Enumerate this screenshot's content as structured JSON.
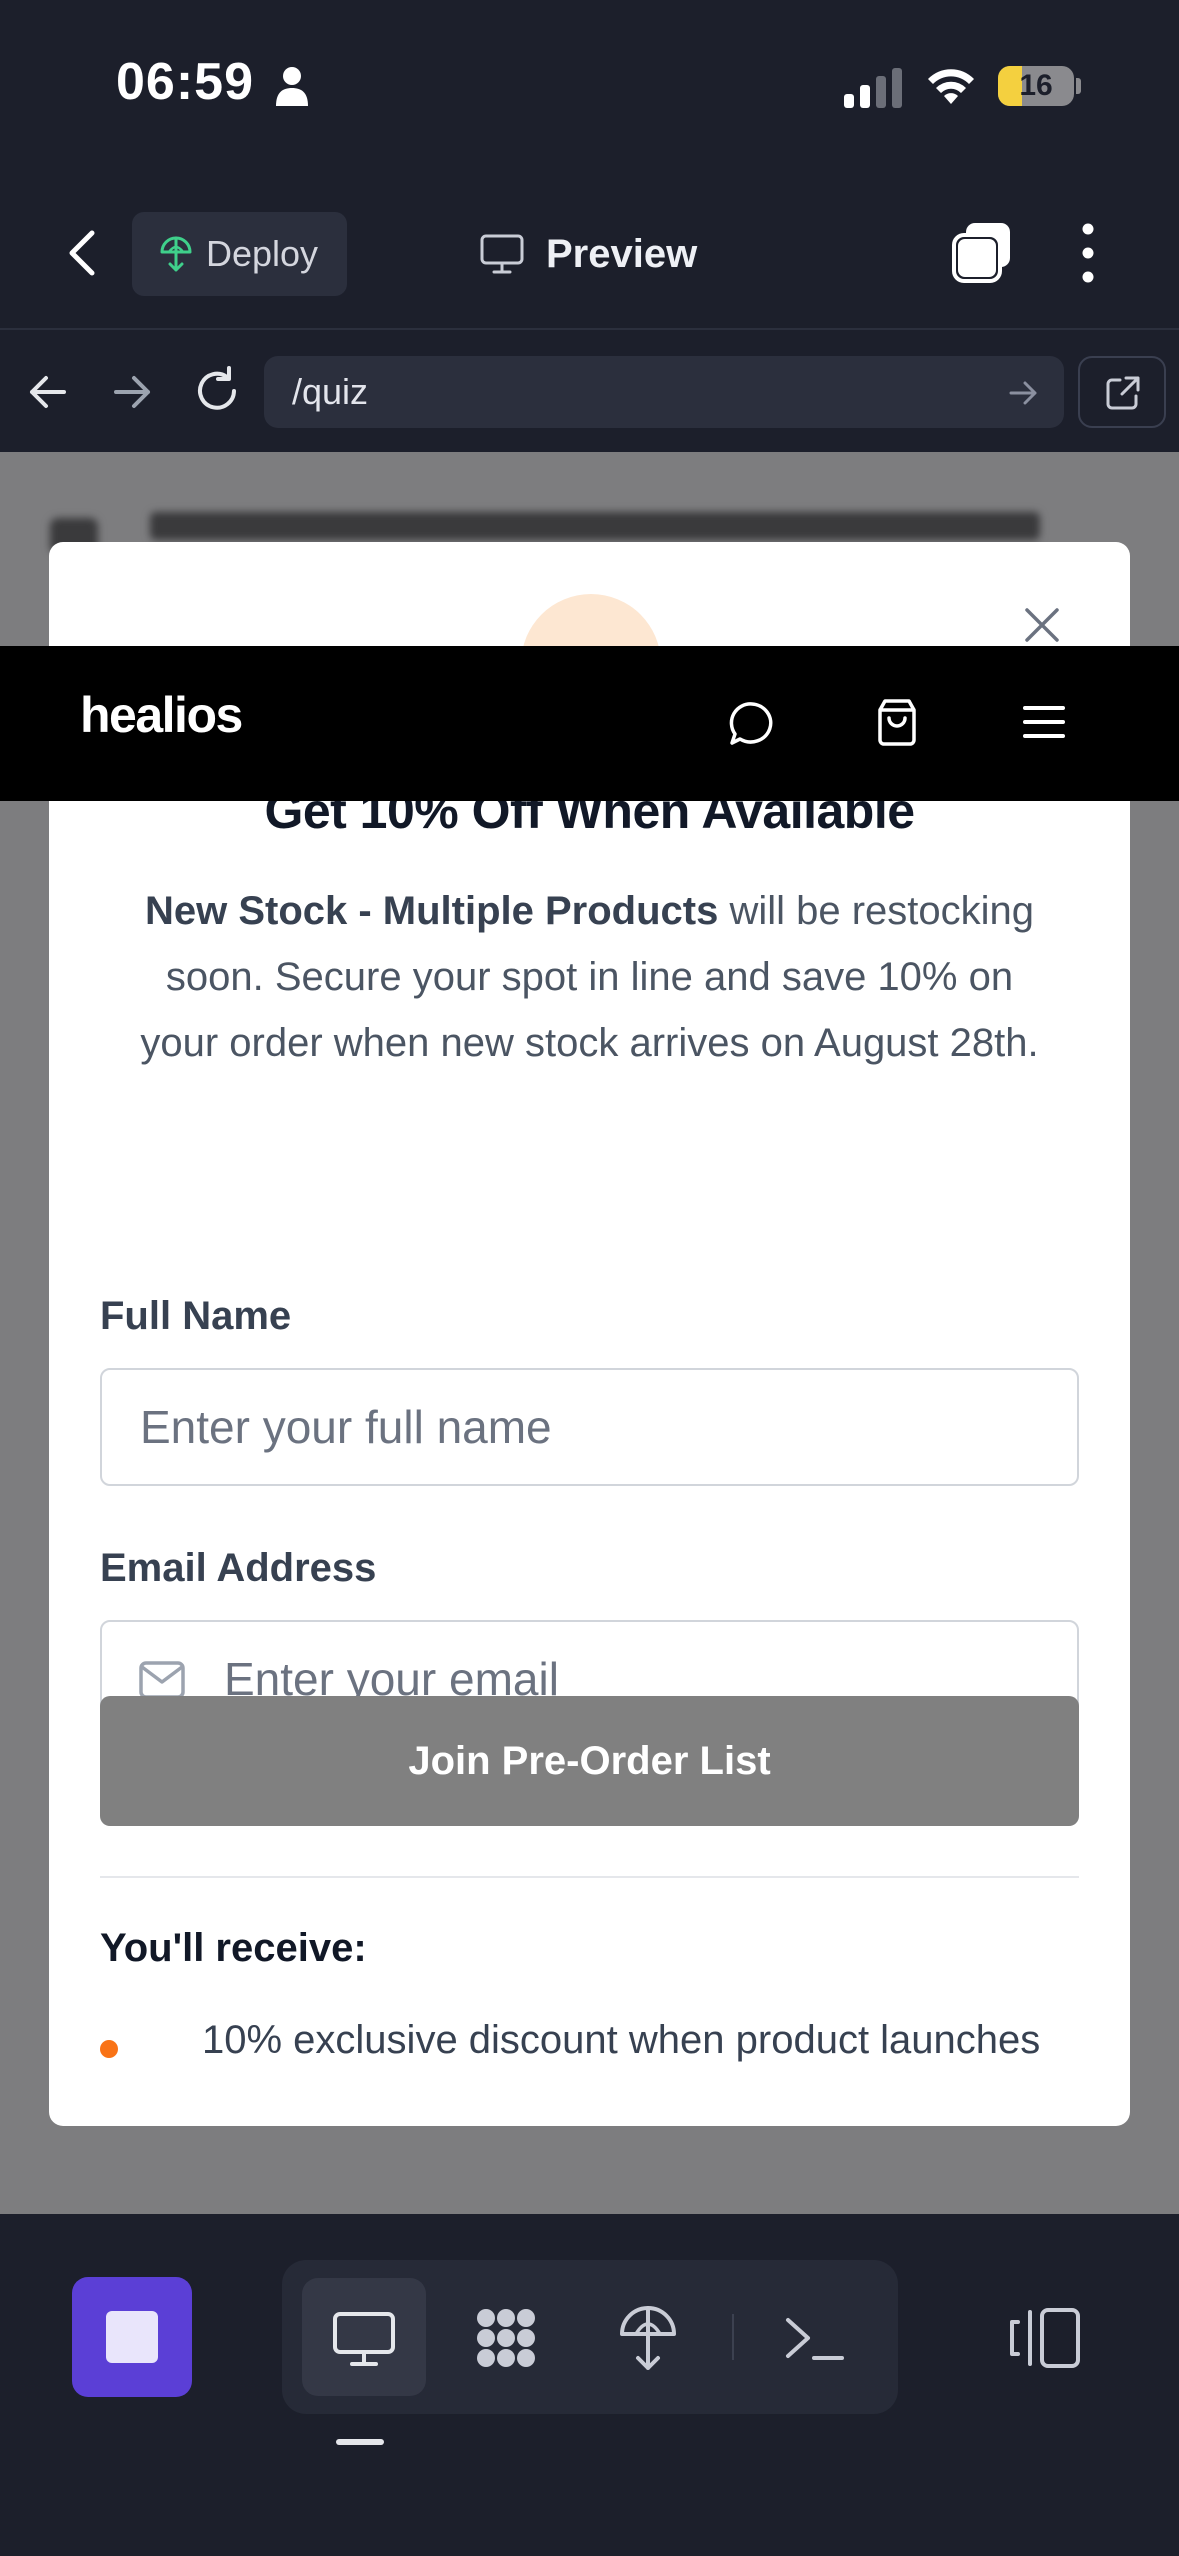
{
  "status_bar": {
    "time": "06:59",
    "battery": "16"
  },
  "app_header": {
    "deploy_label": "Deploy",
    "preview_label": "Preview"
  },
  "url_bar": {
    "url": "/quiz"
  },
  "site_nav": {
    "logo": "healios"
  },
  "modal": {
    "title": "Get 10% Off When Available",
    "desc_bold": "New Stock - Multiple Products",
    "desc_rest": " will be restocking soon. Secure your spot in line and save 10% on your order when new stock arrives on August 28th.",
    "full_name_label": "Full Name",
    "full_name_placeholder": "Enter your full name",
    "email_label": "Email Address",
    "email_placeholder": "Enter your email",
    "submit_label": "Join Pre-Order List",
    "receive_heading": "You'll receive:",
    "benefits": [
      "10% exclusive discount when product launches"
    ]
  },
  "icons": {
    "status": [
      "person-icon",
      "signal-icon",
      "wifi-icon",
      "battery-icon"
    ],
    "header": [
      "back-icon",
      "deploy-icon",
      "monitor-icon",
      "tabs-icon",
      "more-icon"
    ],
    "url_bar": [
      "arrow-left-icon",
      "arrow-right-icon",
      "reload-icon",
      "go-arrow-icon",
      "external-link-icon"
    ],
    "site_nav": [
      "chat-icon",
      "shopping-bag-icon",
      "menu-icon"
    ],
    "bottom_bar": [
      "stop-icon",
      "desktop-icon",
      "apps-icon",
      "deploy-icon",
      "terminal-icon",
      "side-panel-icon"
    ]
  },
  "colors": {
    "app_bg": "#1c1f2b",
    "accent_purple": "#5b3fd6",
    "bullet_orange": "#f97316",
    "submit_button": "#808080",
    "overlay": "#7d7d7f"
  }
}
